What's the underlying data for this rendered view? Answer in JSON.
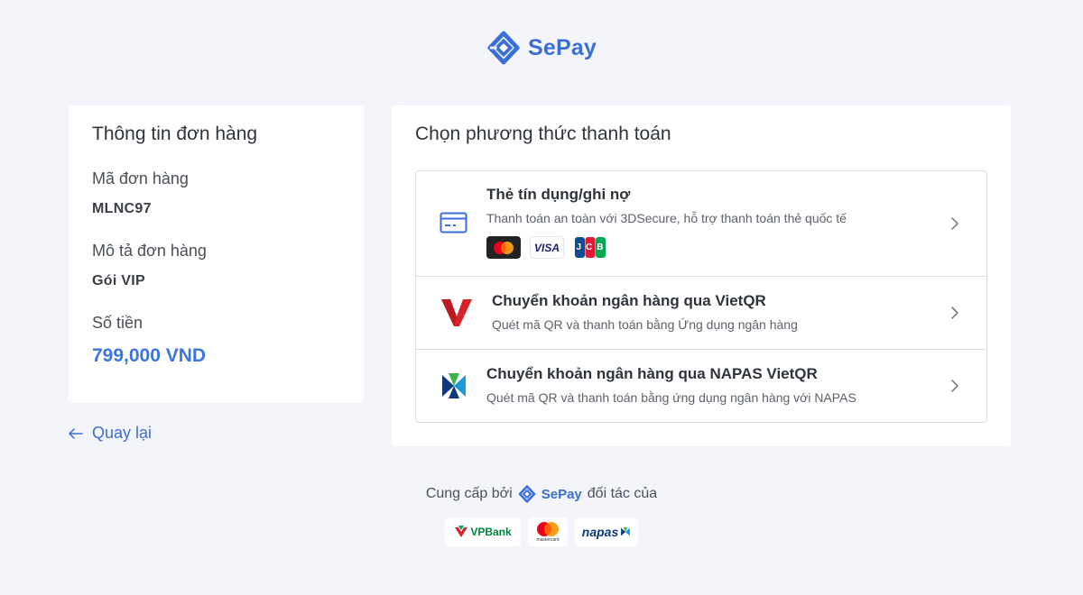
{
  "brand": {
    "name": "SePay",
    "logo_icon": "sepay-logo-icon"
  },
  "order": {
    "title": "Thông tin đơn hàng",
    "order_id_label": "Mã đơn hàng",
    "order_id": "MLNC97",
    "description_label": "Mô tả đơn hàng",
    "description": "Gói VIP",
    "amount_label": "Số tiền",
    "amount": "799,000 VND"
  },
  "back": {
    "label": "Quay lại",
    "icon": "arrow-left-icon"
  },
  "payment": {
    "title": "Chọn phương thức thanh toán",
    "methods": [
      {
        "name": "Thẻ tín dụng/ghi nợ",
        "description": "Thanh toán an toàn với 3DSecure, hỗ trợ thanh toán thẻ quốc tế",
        "icon": "credit-card-icon",
        "brands": [
          "mastercard-logo",
          "visa-logo",
          "jcb-logo"
        ],
        "visa_text": "VISA",
        "jcb_text": "JCB"
      },
      {
        "name": "Chuyển khoản ngân hàng qua VietQR",
        "description": "Quét mã QR và thanh toán bằng Ứng dụng ngân hàng",
        "icon": "vietqr-icon"
      },
      {
        "name": "Chuyển khoản ngân hàng qua NAPAS VietQR",
        "description": "Quét mã QR và thanh toán bằng ứng dụng ngân hàng với NAPAS",
        "icon": "napas-icon"
      }
    ]
  },
  "footer": {
    "provided_by": "Cung cấp bởi",
    "brand": "SePay",
    "partner_text": "đối tác của",
    "partners": {
      "vpbank": "VPBank",
      "mastercard": "mastercard",
      "napas": "napas"
    }
  },
  "colors": {
    "accent": "#3b6fd8",
    "amount": "#3b76e0",
    "background": "#f3f5fa"
  }
}
